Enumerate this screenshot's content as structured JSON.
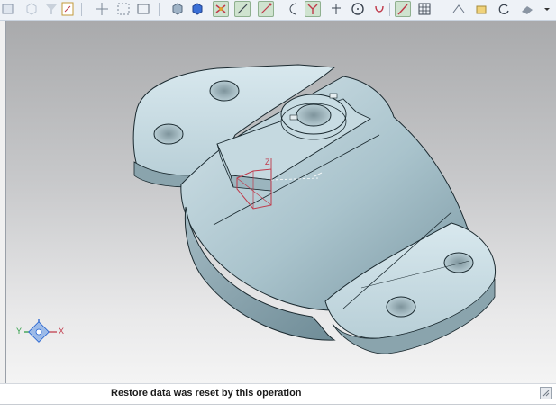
{
  "window": {
    "kind": "cad-3d-viewer"
  },
  "toolbar": {
    "icons": [
      "view-cube-icon",
      "shaded-box-icon",
      "display-mode-icon",
      "sketch-curve-icon",
      "line-tool-icon",
      "arc-tool-icon",
      "constraint-icon",
      "point-tool-icon",
      "circle-tool-icon",
      "snap-icon",
      "active-line-tool-icon",
      "grid-icon",
      "measure-icon",
      "highlight-icon",
      "filter-icon"
    ],
    "active_tool": "line-tool"
  },
  "viewport": {
    "model": "pipe-clamp-bracket",
    "triad_labels": {
      "x": "X",
      "y": "Y",
      "z": "Z"
    },
    "colors": {
      "part_face": "#a9c3cc",
      "part_edge": "#1b2a30",
      "sketch": "#c0394a",
      "bg_top": "#a9aaac",
      "bg_bottom": "#f4f4f4"
    }
  },
  "status": {
    "message": "Restore data was reset by this operation"
  }
}
